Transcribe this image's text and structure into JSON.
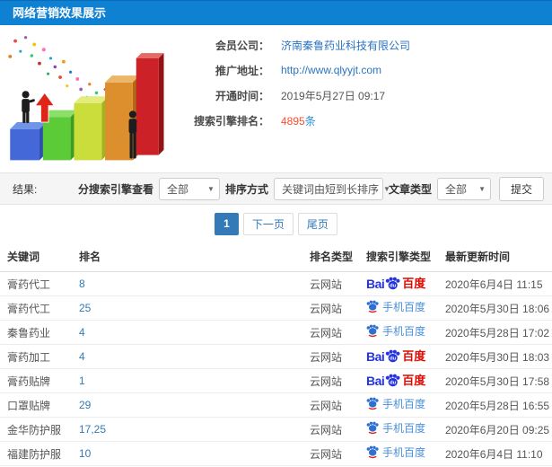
{
  "header": {
    "title": "网络营销效果展示"
  },
  "illustration": {
    "alt": "3d-growth-bar-chart"
  },
  "info": {
    "company_label": "会员公司：",
    "company_value": "济南秦鲁药业科技有限公司",
    "url_label": "推广地址：",
    "url_value": "http://www.qlyyjt.com",
    "open_time_label": "开通时间：",
    "open_time_value": "2019年5月27日 09:17",
    "rank_label": "搜索引擎排名：",
    "rank_count": "4895",
    "rank_unit": "条"
  },
  "filters": {
    "results_label": "结果:",
    "engine_label": "分搜索引擎查看",
    "engine_value": "全部",
    "sort_label": "排序方式",
    "sort_value": "关键词由短到长排序",
    "type_label": "文章类型",
    "type_value": "全部",
    "submit_label": "提交"
  },
  "pagination": {
    "current": "1",
    "next": "下一页",
    "last": "尾页"
  },
  "table": {
    "headers": [
      "关键词",
      "排名",
      "排名类型",
      "搜索引擎类型",
      "最新更新时间"
    ],
    "rows": [
      {
        "keyword": "膏药代工",
        "rank": "8",
        "rank_type": "云网站",
        "engine": "baidu-pc",
        "updated": "2020年6月4日 11:15"
      },
      {
        "keyword": "膏药代工",
        "rank": "25",
        "rank_type": "云网站",
        "engine": "baidu-mobile",
        "updated": "2020年5月30日 18:06"
      },
      {
        "keyword": "秦鲁药业",
        "rank": "4",
        "rank_type": "云网站",
        "engine": "baidu-mobile",
        "updated": "2020年5月28日 17:02"
      },
      {
        "keyword": "膏药加工",
        "rank": "4",
        "rank_type": "云网站",
        "engine": "baidu-pc",
        "updated": "2020年5月30日 18:03"
      },
      {
        "keyword": "膏药贴牌",
        "rank": "1",
        "rank_type": "云网站",
        "engine": "baidu-pc",
        "updated": "2020年5月30日 17:58"
      },
      {
        "keyword": "口罩贴牌",
        "rank": "29",
        "rank_type": "云网站",
        "engine": "baidu-mobile",
        "updated": "2020年5月28日 16:55"
      },
      {
        "keyword": "金华防护服",
        "rank": "17,25",
        "rank_type": "云网站",
        "engine": "baidu-mobile",
        "updated": "2020年6月20日 09:25"
      },
      {
        "keyword": "福建防护服",
        "rank": "10",
        "rank_type": "云网站",
        "engine": "baidu-mobile",
        "updated": "2020年6月4日 11:10"
      }
    ]
  },
  "logos": {
    "baidu_pc": {
      "bai": "Bai",
      "du": "du",
      "cn": "百度"
    },
    "baidu_mobile": {
      "label": "手机百度"
    }
  },
  "colors": {
    "header_bg": "#0f81d2",
    "link": "#2b74c2",
    "accent": "#ff4a2b",
    "baidu_blue": "#2534dc",
    "baidu_red": "#dd0a01",
    "pagination_active": "#337ab7"
  }
}
